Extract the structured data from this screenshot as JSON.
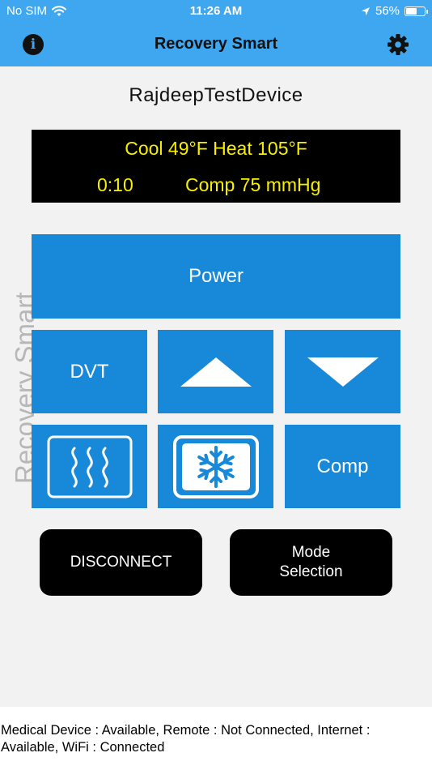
{
  "status_bar": {
    "carrier": "No SIM",
    "time": "11:26 AM",
    "battery": "56%",
    "battery_level": 0.56
  },
  "nav": {
    "title": "Recovery Smart",
    "info_icon": "info-icon",
    "settings_icon": "gear-icon"
  },
  "device": {
    "name": "RajdeepTestDevice"
  },
  "display": {
    "line1": "Cool 49°F Heat 105°F",
    "timer": "0:10",
    "comp": "Comp 75 mmHg",
    "background": "#000000",
    "text_color": "#f6f000"
  },
  "brand_watermark": "Recovery Smart",
  "controls": {
    "power_label": "Power",
    "dvt_label": "DVT",
    "up_icon": "triangle-up-icon",
    "down_icon": "triangle-down-icon",
    "heat_icon": "heat-waves-icon",
    "cool_icon": "snowflake-icon",
    "comp_label": "Comp",
    "tile_color": "#1888d8"
  },
  "actions": {
    "disconnect_label": "DISCONNECT",
    "mode_label_line1": "Mode",
    "mode_label_line2": "Selection"
  },
  "footer": {
    "status_text": "Medical Device : Available, Remote : Not Connected, Internet : Available, WiFi : Connected"
  },
  "colors": {
    "header": "#3fa7ef",
    "content_bg": "#f2f2f2"
  }
}
